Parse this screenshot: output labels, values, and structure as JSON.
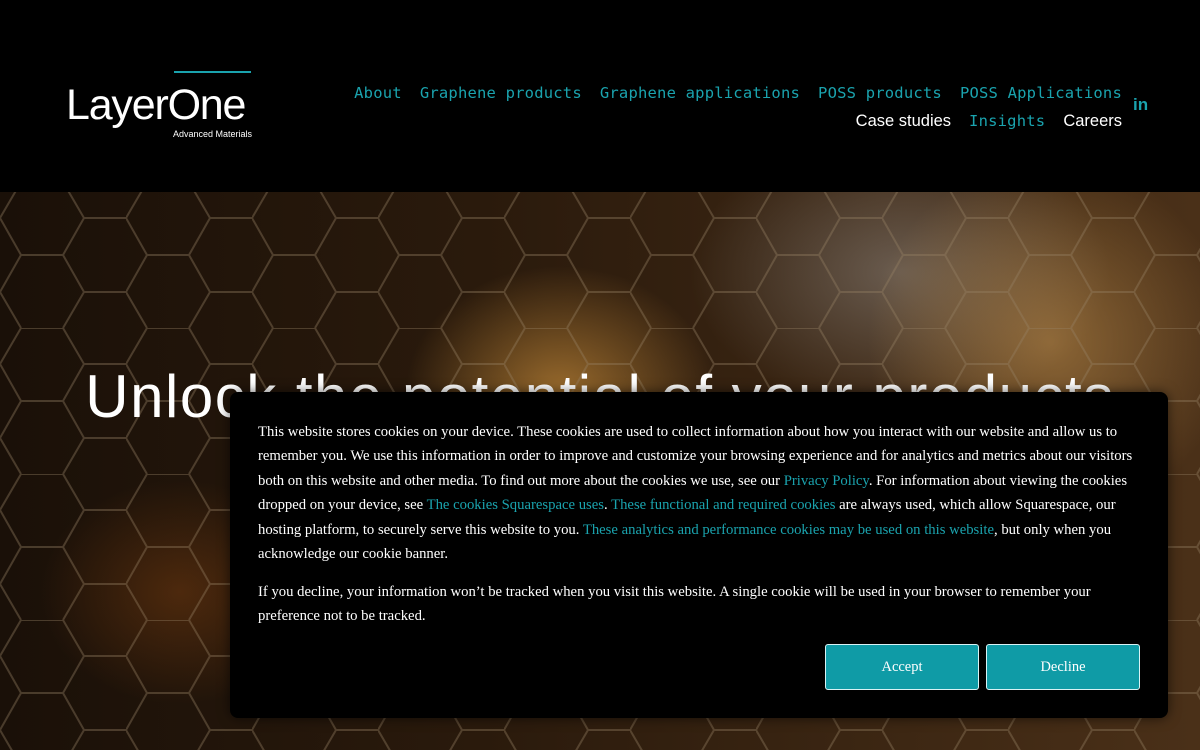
{
  "brand": {
    "name": "LayerOne",
    "tagline": "Advanced Materials",
    "accent_color": "#1aa3ae"
  },
  "nav": {
    "row1": [
      {
        "label": "About"
      },
      {
        "label": "Graphene products"
      },
      {
        "label": "Graphene applications"
      },
      {
        "label": "POSS products"
      },
      {
        "label": "POSS Applications"
      }
    ],
    "row2": [
      {
        "label": "Case studies"
      },
      {
        "label": "Insights"
      },
      {
        "label": "Careers"
      }
    ],
    "social_icon": "linkedin-icon",
    "social_label": "in"
  },
  "hero": {
    "title": "Unlock the potential of your products with"
  },
  "cookie_banner": {
    "p1_a": "This website stores cookies on your device. These cookies are used to collect information about how you interact with our website and allow us to remember you. We use this information in order to improve and customize your browsing experience and for analytics and metrics about our visitors both on this website and other media. To find out more about the cookies we use, see our ",
    "privacy_link": "Privacy Policy",
    "p1_b": ". For information about viewing the cookies dropped on your device, see ",
    "squarespace_link": "The cookies Squarespace uses",
    "p1_c": ". ",
    "functional_link": "These functional and required cookies",
    "p1_d": " are always used, which allow Squarespace, our hosting platform, to securely serve this website to you. ",
    "analytics_link": "These analytics and performance cookies may be used on this website",
    "p1_e": ", but only when you acknowledge our cookie banner.",
    "p2": "If you decline, your information won’t be tracked when you visit this website. A single cookie will be used in your browser to remember your preference not to be tracked.",
    "accept_label": "Accept",
    "decline_label": "Decline"
  }
}
